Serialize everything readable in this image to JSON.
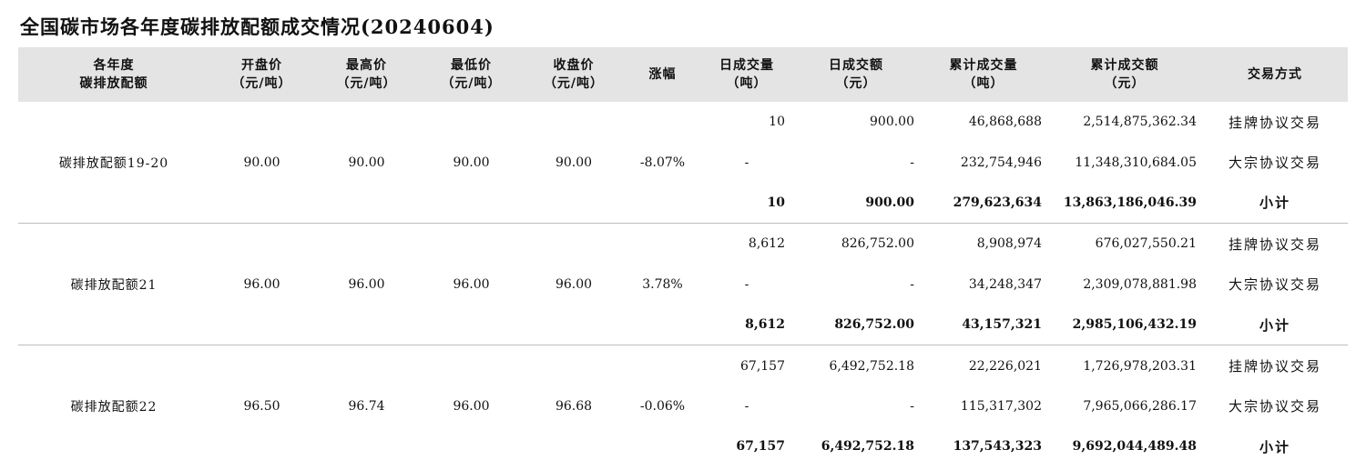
{
  "title": "全国碳市场各年度碳排放配额成交情况(20240604)",
  "headers": [
    [
      "各年度",
      "碳排放配额"
    ],
    [
      "开盘价",
      "（元/吨）"
    ],
    [
      "最高价",
      "（元/吨）"
    ],
    [
      "最低价",
      "（元/吨）"
    ],
    [
      "收盘价",
      "（元/吨）"
    ],
    [
      "涨幅"
    ],
    [
      "日成交量",
      "（吨）"
    ],
    [
      "日成交额",
      "（元）"
    ],
    [
      "累计成交量",
      "（吨）"
    ],
    [
      "累计成交额",
      "（元）"
    ],
    [
      "交易方式"
    ]
  ],
  "groups": [
    {
      "name": "碳排放配额19-20",
      "open": "90.00",
      "high": "90.00",
      "low": "90.00",
      "close": "90.00",
      "change": "-8.07%",
      "rows": [
        {
          "daily_vol": "10",
          "daily_amt": "900.00",
          "cum_vol": "46,868,688",
          "cum_amt": "2,514,875,362.34",
          "method": "挂牌协议交易"
        },
        {
          "daily_vol": "-",
          "daily_amt": "-",
          "cum_vol": "232,754,946",
          "cum_amt": "11,348,310,684.05",
          "method": "大宗协议交易"
        },
        {
          "daily_vol": "10",
          "daily_amt": "900.00",
          "cum_vol": "279,623,634",
          "cum_amt": "13,863,186,046.39",
          "method": "小计"
        }
      ]
    },
    {
      "name": "碳排放配额21",
      "open": "96.00",
      "high": "96.00",
      "low": "96.00",
      "close": "96.00",
      "change": "3.78%",
      "rows": [
        {
          "daily_vol": "8,612",
          "daily_amt": "826,752.00",
          "cum_vol": "8,908,974",
          "cum_amt": "676,027,550.21",
          "method": "挂牌协议交易"
        },
        {
          "daily_vol": "-",
          "daily_amt": "-",
          "cum_vol": "34,248,347",
          "cum_amt": "2,309,078,881.98",
          "method": "大宗协议交易"
        },
        {
          "daily_vol": "8,612",
          "daily_amt": "826,752.00",
          "cum_vol": "43,157,321",
          "cum_amt": "2,985,106,432.19",
          "method": "小计"
        }
      ]
    },
    {
      "name": "碳排放配额22",
      "open": "96.50",
      "high": "96.74",
      "low": "96.00",
      "close": "96.68",
      "change": "-0.06%",
      "rows": [
        {
          "daily_vol": "67,157",
          "daily_amt": "6,492,752.18",
          "cum_vol": "22,226,021",
          "cum_amt": "1,726,978,203.31",
          "method": "挂牌协议交易"
        },
        {
          "daily_vol": "-",
          "daily_amt": "-",
          "cum_vol": "115,317,302",
          "cum_amt": "7,965,066,286.17",
          "method": "大宗协议交易"
        },
        {
          "daily_vol": "67,157",
          "daily_amt": "6,492,752.18",
          "cum_vol": "137,543,323",
          "cum_amt": "9,692,044,489.48",
          "method": "小计"
        }
      ]
    }
  ]
}
